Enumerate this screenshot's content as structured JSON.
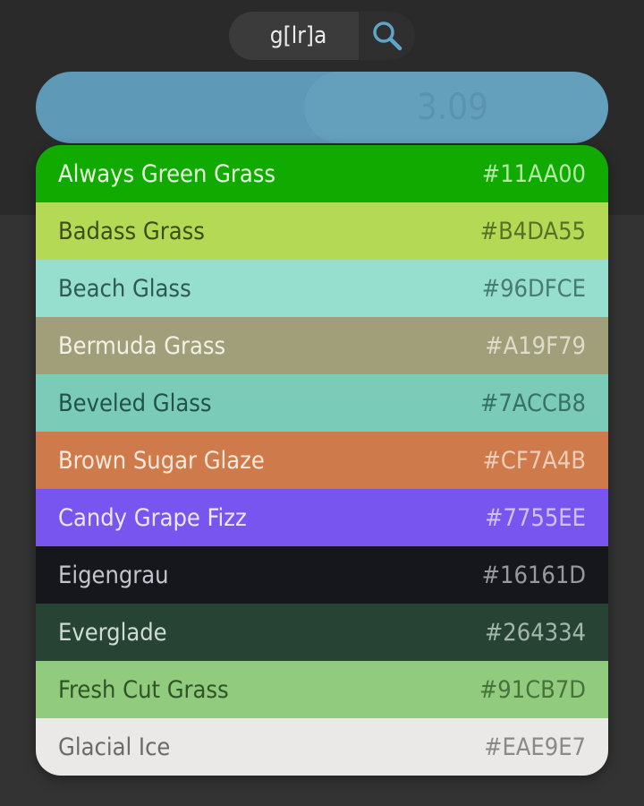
{
  "search": {
    "value": "g[lr]a",
    "icon": "search-icon",
    "icon_color": "#5fa4c9"
  },
  "contrast": {
    "value": "3.09",
    "bar_color": "#5f99b8"
  },
  "colors": [
    {
      "name": "Always Green Grass",
      "hex": "#11AA00",
      "text": "#e8ffe0"
    },
    {
      "name": "Badass Grass",
      "hex": "#B4DA55",
      "text": "#3d4d18"
    },
    {
      "name": "Beach Glass",
      "hex": "#96DFCE",
      "text": "#2d5a52"
    },
    {
      "name": "Bermuda Grass",
      "hex": "#A19F79",
      "text": "#f1f0e6"
    },
    {
      "name": "Beveled Glass",
      "hex": "#7ACCB8",
      "text": "#22524a"
    },
    {
      "name": "Brown Sugar Glaze",
      "hex": "#CF7A4B",
      "text": "#fae8dc"
    },
    {
      "name": "Candy Grape Fizz",
      "hex": "#7755EE",
      "text": "#ece6ff"
    },
    {
      "name": "Eigengrau",
      "hex": "#16161D",
      "text": "#c4c4cc"
    },
    {
      "name": "Everglade",
      "hex": "#264334",
      "text": "#cfdcd4"
    },
    {
      "name": "Fresh Cut Grass",
      "hex": "#91CB7D",
      "text": "#2f5526"
    },
    {
      "name": "Glacial Ice",
      "hex": "#EAE9E7",
      "text": "#6a6a6a"
    }
  ]
}
